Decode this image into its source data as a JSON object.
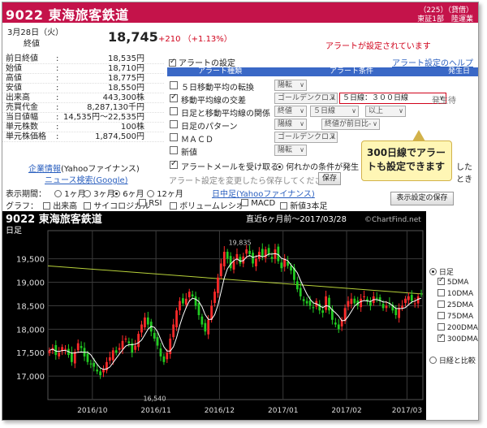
{
  "header": {
    "title": "9022 東海旅客鉄道",
    "industry_code": "（225）（貸借）",
    "market": "東証1部　陸運業"
  },
  "summary": {
    "date": "3月28日（火）",
    "close_label": "終値",
    "price": "18,745",
    "change": "+210 （+1.13%）",
    "alert_status": "アラートが設定されています"
  },
  "quote": [
    {
      "k": "前日終値",
      "v": "18,535円"
    },
    {
      "k": "始値",
      "v": "18,710円"
    },
    {
      "k": "高値",
      "v": "18,775円"
    },
    {
      "k": "安値",
      "v": "18,550円"
    },
    {
      "k": "出来高",
      "v": "443,300株"
    },
    {
      "k": "売買代金",
      "v": "8,287,130千円"
    },
    {
      "k": "当日値幅",
      "v": "14,535円〜22,535円"
    },
    {
      "k": "単元株数",
      "v": "100株"
    },
    {
      "k": "単元株価格",
      "v": "1,874,500円"
    }
  ],
  "quote_sep": ":",
  "links": {
    "corp_prefix": "企業情報",
    "corp_suffix": "(Yahooファイナンス)",
    "news": "ニュース検索(Google)"
  },
  "alert": {
    "header": "アラートの設定",
    "help": "アラート設定のヘルプ",
    "col_type": "アラート種類",
    "col_cond": "アラート条件",
    "col_trig": "発生日",
    "rows": [
      {
        "name": "５日移動平均の転換",
        "checked": false,
        "s1": "陽転",
        "s2": "",
        "s3": "",
        "trig": ""
      },
      {
        "name": "移動平均線の交差",
        "checked": true,
        "s1": "ゴールデンクロス",
        "s2": "５日線：３００日線",
        "s3": "",
        "trig": "発生待"
      },
      {
        "name": "日足と移動平均線の関係",
        "checked": false,
        "s1": "終値",
        "s2": "５日線",
        "s3": "以上",
        "trig": ""
      },
      {
        "name": "日足のパターン",
        "checked": false,
        "s1": "陽線",
        "s2": "終値が前日比-",
        "s3": "",
        "trig": ""
      },
      {
        "name": "ＭＡＣＤ",
        "checked": false,
        "s1": "ゴールデンクロス",
        "s2": "",
        "s3": "",
        "trig": ""
      },
      {
        "name": "新値",
        "checked": false,
        "s1": "陽転",
        "s2": "",
        "s3": "",
        "trig": ""
      }
    ],
    "mail_label": "アラートメールを受け取る",
    "mail_option": "何れかの条件が発生",
    "mail_tail": "したとき",
    "change_note": "アラート設定を変更したら保存してください",
    "save_button": "保存"
  },
  "callout": "300日線でアラートも設定できます",
  "period": {
    "label": "表示期間：",
    "options": [
      "1ヶ月",
      "3ヶ月",
      "6ヶ月",
      "12ヶ月"
    ],
    "selected": 2,
    "source": "日中足(Yahooファイナンス)"
  },
  "graph": {
    "label": "グラフ：",
    "options": [
      "出来高",
      "サイコロジカル",
      "RSI",
      "ボリュームレシオ",
      "MACD",
      "新値3本足"
    ],
    "save_view": "表示設定の保存"
  },
  "chart_title": "9022 東海旅客鉄道",
  "chart_range": "直近6ヶ月前〜2017/03/28",
  "chart_copyright": "©ChartFind.net",
  "chart_data": {
    "type": "candlestick",
    "title": "9022 東海旅客鉄道",
    "ylabel": "日足",
    "ylim": [
      16500,
      20100
    ],
    "yticks": [
      17000,
      17500,
      18000,
      18500,
      19000,
      19500
    ],
    "xticks": [
      "2016/10",
      "2016/11",
      "2016/12",
      "2017/01",
      "2017/02",
      "2017/03"
    ],
    "annotations": [
      {
        "text": "19,835",
        "value": 19835
      },
      {
        "text": "16,540",
        "value": 16540
      }
    ],
    "series_close": [
      17550,
      17600,
      17450,
      17500,
      17620,
      17580,
      17450,
      17300,
      17520,
      17700,
      17600,
      17420,
      17300,
      17250,
      17200,
      17100,
      17020,
      17150,
      17300,
      17400,
      17550,
      17500,
      17600,
      17750,
      17800,
      17700,
      17500,
      17650,
      17900,
      18100,
      18250,
      18100,
      17950,
      17800,
      17650,
      17420,
      17300,
      17500,
      17800,
      18100,
      18400,
      18600,
      18550,
      18650,
      18800,
      18700,
      18500,
      18300,
      18100,
      17950,
      18200,
      18500,
      18800,
      19100,
      19400,
      19650,
      19500,
      19300,
      19450,
      19600,
      19400,
      19550,
      19700,
      19600,
      19400,
      19500,
      19650,
      19550,
      19700,
      19600,
      19500,
      19700,
      19450,
      19300,
      19500,
      19350,
      19250,
      19050,
      18850,
      18700,
      18600,
      18550,
      18500,
      18450,
      18600,
      18400,
      18350,
      18700,
      18400,
      18200,
      18100,
      18000,
      18200,
      18450,
      18600,
      18650,
      18550,
      18500,
      18650,
      18700,
      18600,
      18500,
      18700,
      18650,
      18600,
      18450,
      18500,
      18550,
      18400,
      18300,
      18450,
      18500,
      18650,
      18700,
      18600,
      18550,
      18700,
      18745
    ],
    "ma300": [
      19350,
      18750
    ],
    "legend": {
      "mode_daily": "日足",
      "items": [
        {
          "name": "5DMA",
          "checked": true
        },
        {
          "name": "10DMA",
          "checked": false
        },
        {
          "name": "25DMA",
          "checked": false
        },
        {
          "name": "75DMA",
          "checked": false
        },
        {
          "name": "200DMA",
          "checked": false
        },
        {
          "name": "300DMA",
          "checked": true
        }
      ],
      "compare": "日経と比較"
    }
  },
  "colors": {
    "brand": "#c4134a",
    "up": "#ff2a2a",
    "down": "#22cc22",
    "ma5": "#ffffff",
    "ma300": "#b8d23a"
  }
}
